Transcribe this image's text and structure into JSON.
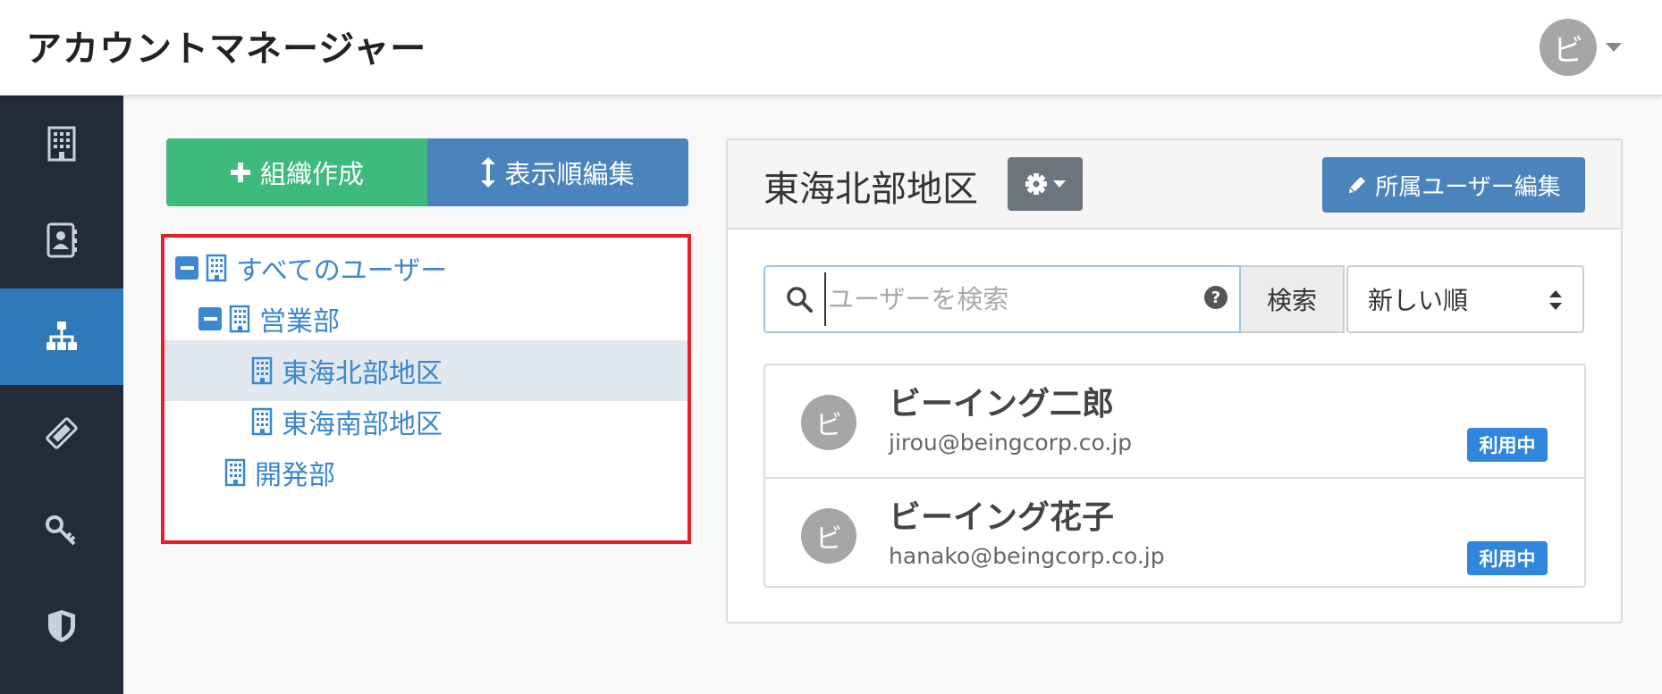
{
  "app": {
    "title": "アカウントマネージャー"
  },
  "user_menu": {
    "avatar_initial": "ビ"
  },
  "sidebar": {
    "items": [
      {
        "icon": "building-icon",
        "active": false
      },
      {
        "icon": "address-book-icon",
        "active": false
      },
      {
        "icon": "org-chart-icon",
        "active": true
      },
      {
        "icon": "ticket-icon",
        "active": false
      },
      {
        "icon": "key-icon",
        "active": false
      },
      {
        "icon": "shield-icon",
        "active": false
      }
    ]
  },
  "actions": {
    "create_label": "組織作成",
    "order_label": "表示順編集"
  },
  "tree": {
    "nodes": [
      {
        "label": "すべてのユーザー",
        "level": 0,
        "expanded": true
      },
      {
        "label": "営業部",
        "level": 1,
        "expanded": true
      },
      {
        "label": "東海北部地区",
        "level": 2,
        "selected": true
      },
      {
        "label": "東海南部地区",
        "level": 2
      },
      {
        "label": "開発部",
        "level": 1
      }
    ]
  },
  "panel": {
    "title": "東海北部地区",
    "edit_members_label": "所属ユーザー編集",
    "search": {
      "placeholder": "ユーザーを検索",
      "value": "",
      "button_label": "検索"
    },
    "sort": {
      "selected": "新しい順"
    },
    "users": [
      {
        "initial": "ビ",
        "name": "ビーイング二郎",
        "email": "jirou@beingcorp.co.jp",
        "status": "利用中"
      },
      {
        "initial": "ビ",
        "name": "ビーイング花子",
        "email": "hanako@beingcorp.co.jp",
        "status": "利用中"
      }
    ]
  },
  "colors": {
    "sidebar_bg": "#222b38",
    "sidebar_active": "#2f78ba",
    "create_button": "#3fba7d",
    "primary_button": "#4b84bc",
    "tree_link": "#3a87cf",
    "highlight_border": "#e3212b",
    "status_badge": "#2f86dc"
  }
}
